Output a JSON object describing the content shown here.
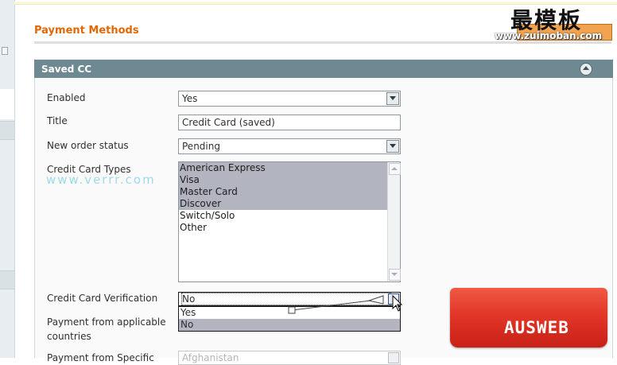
{
  "page": {
    "title": "Payment Methods"
  },
  "logo": {
    "text": "最模板",
    "url": "www.zuimoban.com"
  },
  "watermark": {
    "text": "www.verrr.com"
  },
  "panel": {
    "title": "Saved CC"
  },
  "form": {
    "enabled": {
      "label": "Enabled",
      "value": "Yes"
    },
    "title": {
      "label": "Title",
      "value": "Credit Card (saved)"
    },
    "order_status": {
      "label": "New order status",
      "value": "Pending"
    },
    "cc_types": {
      "label": "Credit Card Types",
      "options": [
        {
          "label": "American Express",
          "selected": true
        },
        {
          "label": "Visa",
          "selected": true
        },
        {
          "label": "Master Card",
          "selected": true
        },
        {
          "label": "Discover",
          "selected": true
        },
        {
          "label": "Switch/Solo",
          "selected": false
        },
        {
          "label": "Other",
          "selected": false
        }
      ]
    },
    "cc_verification": {
      "label": "Credit Card Verification",
      "value": "No",
      "options": [
        "Yes",
        "No"
      ],
      "highlighted": "No"
    },
    "applicable_countries": {
      "label": "Payment from applicable countries"
    },
    "specific_countries": {
      "label": "Payment from Specific",
      "value": "Afghanistan"
    }
  },
  "brand": {
    "text": "AUSWEB"
  },
  "colors": {
    "accent": "#e26703",
    "panel_header": "#6f8992",
    "selection": "#b2b4c0"
  }
}
